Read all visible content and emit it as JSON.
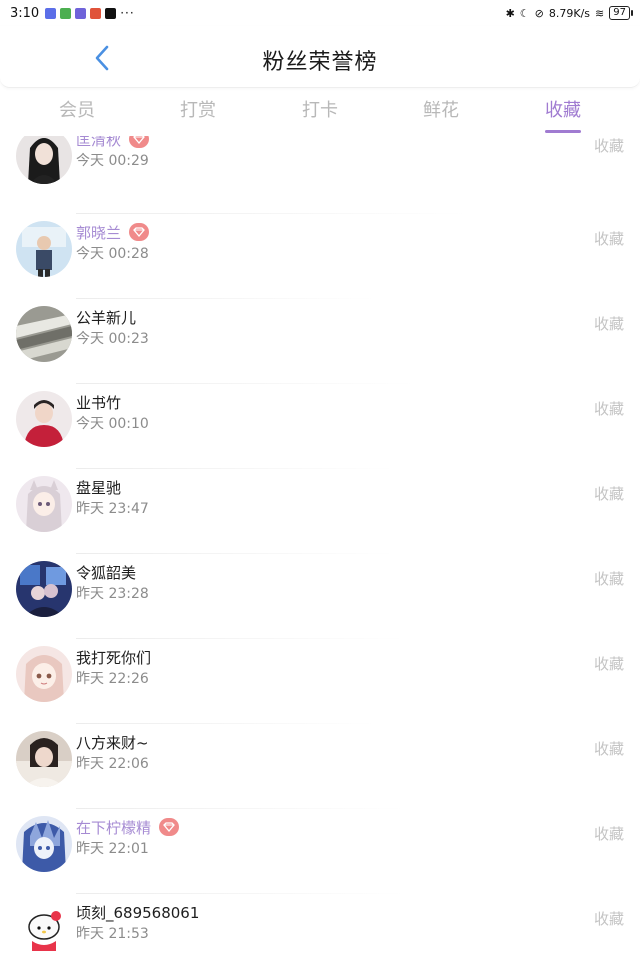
{
  "status_bar": {
    "time": "3:10",
    "more": "···",
    "network_speed": "8.79K/s",
    "battery": "97",
    "app_icon_colors": [
      "#5b6ee8",
      "#4caf50",
      "#6f63d9",
      "#e0533a",
      "#111111"
    ]
  },
  "header": {
    "title": "粉丝荣誉榜",
    "back_icon": "chevron-left-icon",
    "accent_color": "#4a90e2"
  },
  "tabs": [
    {
      "label": "会员",
      "active": false
    },
    {
      "label": "打赏",
      "active": false
    },
    {
      "label": "打卡",
      "active": false
    },
    {
      "label": "鲜花",
      "active": false
    },
    {
      "label": "收藏",
      "active": true
    }
  ],
  "colors": {
    "active_tab": "#a07bd1",
    "vip_name": "#a68bd3",
    "vip_badge": "#f08a8a",
    "time_text": "#8c8c8c",
    "action_text": "#c4c4c4"
  },
  "fans": [
    {
      "name": "匡清秋",
      "vip": true,
      "time": "今天 00:29",
      "action": "收藏"
    },
    {
      "name": "郭晓兰",
      "vip": true,
      "time": "今天 00:28",
      "action": "收藏"
    },
    {
      "name": "公羊新儿",
      "vip": false,
      "time": "今天 00:23",
      "action": "收藏"
    },
    {
      "name": "业书竹",
      "vip": false,
      "time": "今天 00:10",
      "action": "收藏"
    },
    {
      "name": "盘星驰",
      "vip": false,
      "time": "昨天 23:47",
      "action": "收藏"
    },
    {
      "name": "令狐韶美",
      "vip": false,
      "time": "昨天 23:28",
      "action": "收藏"
    },
    {
      "name": "我打死你们",
      "vip": false,
      "time": "昨天 22:26",
      "action": "收藏"
    },
    {
      "name": "八方来财~",
      "vip": false,
      "time": "昨天 22:06",
      "action": "收藏"
    },
    {
      "name": "在下柠檬精",
      "vip": true,
      "time": "昨天 22:01",
      "action": "收藏"
    },
    {
      "name": "顷刻_689568061",
      "vip": false,
      "time": "昨天 21:53",
      "action": "收藏"
    }
  ]
}
